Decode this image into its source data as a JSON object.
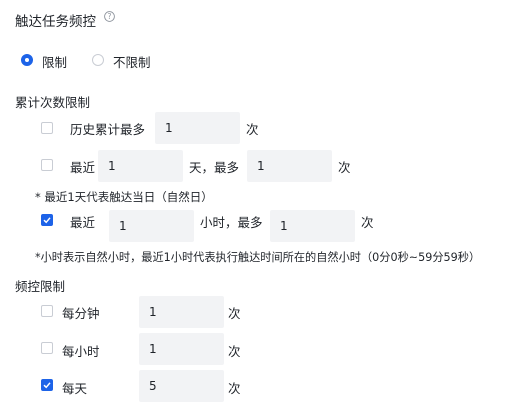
{
  "title": "触达任务频控",
  "limit_mode": {
    "options": [
      {
        "label": "限制",
        "selected": true
      },
      {
        "label": "不限制",
        "selected": false
      }
    ]
  },
  "cumulative": {
    "section_label": "累计次数限制",
    "history": {
      "checked": false,
      "label": "历史累计最多",
      "value": "1",
      "unit": "次"
    },
    "recent_days": {
      "checked": false,
      "label": "最近",
      "days_value": "1",
      "days_unit": "天，最多",
      "count_value": "1",
      "count_unit": "次"
    },
    "days_note": "* 最近1天代表触达当日（自然日）",
    "recent_hours": {
      "checked": true,
      "label": "最近",
      "hours_value": "1",
      "hours_unit": "小时，最多",
      "count_value": "1",
      "count_unit": "次"
    },
    "hours_note": "*小时表示自然小时，最近1小时代表执行触达时间所在的自然小时（0分0秒~59分59秒）"
  },
  "frequency": {
    "section_label": "频控限制",
    "rows": [
      {
        "checked": false,
        "label": "每分钟",
        "value": "1",
        "unit": "次"
      },
      {
        "checked": false,
        "label": "每小时",
        "value": "1",
        "unit": "次"
      },
      {
        "checked": true,
        "label": "每天",
        "value": "5",
        "unit": "次"
      }
    ]
  },
  "colors": {
    "accent": "#1d63e8",
    "input_bg": "#f2f3f5",
    "border": "#c9cdd4"
  }
}
